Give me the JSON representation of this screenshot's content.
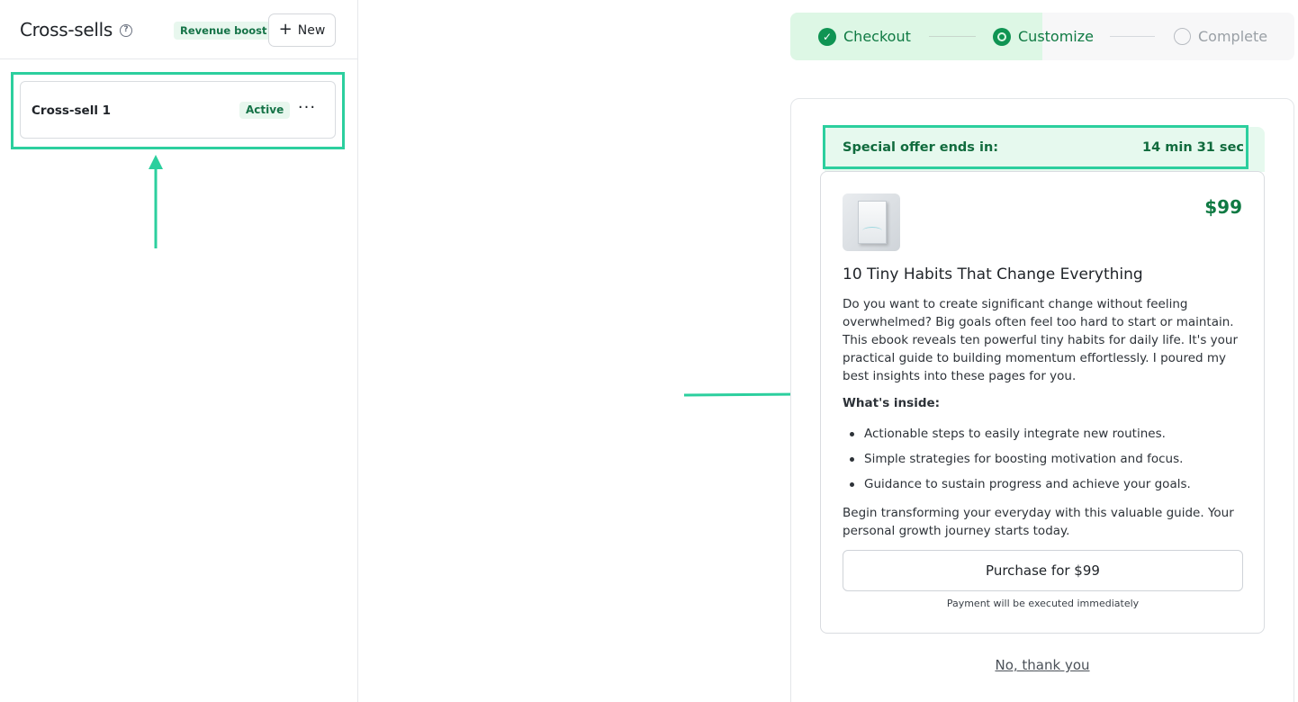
{
  "sidebar": {
    "title": "Cross-sells",
    "help_icon": "?",
    "badge": "Revenue boost",
    "new_button": "New",
    "items": [
      {
        "label": "Cross-sell 1",
        "status": "Active",
        "more": "···"
      }
    ]
  },
  "stepper": {
    "steps": [
      {
        "label": "Checkout",
        "state": "done"
      },
      {
        "label": "Customize",
        "state": "current"
      },
      {
        "label": "Complete",
        "state": "pending"
      }
    ]
  },
  "offer": {
    "label": "Special offer ends in:",
    "timer": "14 min 31 sec"
  },
  "product": {
    "price": "$99",
    "title": "10 Tiny Habits That Change Everything",
    "description": "Do you want to create significant change without feeling overwhelmed? Big goals often feel too hard to start or maintain. This ebook reveals ten powerful tiny habits for daily life. It's your practical guide to building momentum effortlessly. I poured my best insights into these pages for you.",
    "inside_heading": "What's inside:",
    "inside_items": [
      "Actionable steps to easily integrate new routines.",
      "Simple strategies for boosting motivation and focus.",
      "Guidance to sustain progress and achieve your goals."
    ],
    "closing": "Begin transforming your everyday with this valuable guide. Your personal growth journey starts today.",
    "purchase_button": "Purchase for $99",
    "payment_note": "Payment will be executed immediately",
    "decline": "No, thank you"
  },
  "colors": {
    "accent": "#0f9453",
    "highlight": "#2ccf9e",
    "badge_bg": "#e8f7ee"
  }
}
